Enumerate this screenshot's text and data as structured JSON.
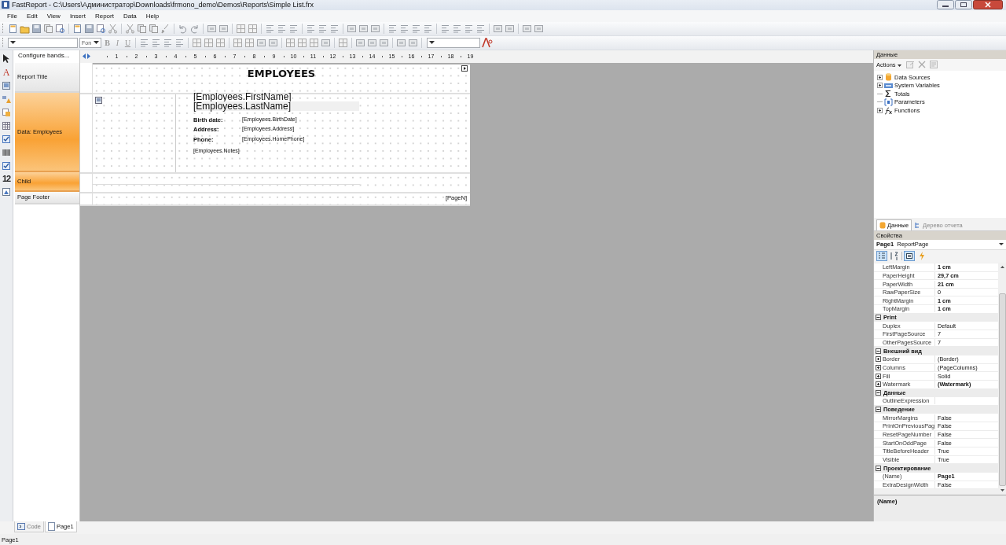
{
  "window": {
    "title": "FastReport - C:\\Users\\Администратор\\Downloads\\frmono_demo\\Demos\\Reports\\Simple List.frx"
  },
  "menu": [
    "File",
    "Edit",
    "View",
    "Insert",
    "Report",
    "Data",
    "Help"
  ],
  "format_toolbar": {
    "size_combo": "Fon",
    "bold": "B",
    "italic": "I",
    "underline": "U"
  },
  "tool_strip": {
    "text_tool": "A",
    "number_tool": "12"
  },
  "band_panel": {
    "configure": "Configure bands...",
    "bands": [
      {
        "label": "Report Title",
        "selected": false
      },
      {
        "label": "Data: Employees",
        "selected": true
      },
      {
        "label": "Child",
        "selected": true
      },
      {
        "label": "Page Footer",
        "selected": false
      }
    ]
  },
  "ruler": {
    "ticks": [
      "1",
      "2",
      "3",
      "4",
      "5",
      "6",
      "7",
      "8",
      "9",
      "10",
      "11",
      "12",
      "13",
      "14",
      "15",
      "16",
      "17",
      "18",
      "19"
    ]
  },
  "report": {
    "title": "EMPLOYEES",
    "first_name": "[Employees.FirstName]",
    "last_name": "[Employees.LastName]",
    "fields": [
      {
        "label": "Birth date:",
        "value": "[Employees.BirthDate]"
      },
      {
        "label": "Address:",
        "value": "[Employees.Address]"
      },
      {
        "label": "Phone:",
        "value": "[Employees.HomePhone]"
      }
    ],
    "notes": "[Employees.Notes]",
    "page_number": "[PageN]"
  },
  "data_panel": {
    "title": "Данные",
    "actions": "Actions",
    "tree": [
      {
        "label": "Data Sources",
        "kind": "datasource",
        "expandable": true
      },
      {
        "label": "System Variables",
        "kind": "variables",
        "expandable": true
      },
      {
        "label": "Totals",
        "kind": "totals",
        "expandable": false
      },
      {
        "label": "Parameters",
        "kind": "parameters",
        "expandable": false
      },
      {
        "label": "Functions",
        "kind": "functions",
        "expandable": true
      }
    ],
    "tabs": [
      {
        "label": "Данные",
        "selected": true
      },
      {
        "label": "Дерево отчета",
        "selected": false
      }
    ]
  },
  "properties": {
    "title": "Свойства",
    "object": {
      "name": "Page1",
      "type": "ReportPage"
    },
    "view_buttons": [
      {
        "kind": "categorized",
        "selected": true
      },
      {
        "kind": "alphabetical",
        "selected": false
      },
      {
        "kind": "properties",
        "selected": true
      },
      {
        "kind": "events",
        "selected": false
      }
    ],
    "rows": [
      {
        "kind": "prop",
        "name": "LeftMargin",
        "value": "1 cm",
        "modified": true,
        "expandable": false
      },
      {
        "kind": "prop",
        "name": "PaperHeight",
        "value": "29,7 cm",
        "modified": true,
        "expandable": false
      },
      {
        "kind": "prop",
        "name": "PaperWidth",
        "value": "21 cm",
        "modified": true,
        "expandable": false
      },
      {
        "kind": "prop",
        "name": "RawPaperSize",
        "value": "0",
        "modified": false,
        "expandable": false
      },
      {
        "kind": "prop",
        "name": "RightMargin",
        "value": "1 cm",
        "modified": true,
        "expandable": false
      },
      {
        "kind": "prop",
        "name": "TopMargin",
        "value": "1 cm",
        "modified": true,
        "expandable": false
      },
      {
        "kind": "category",
        "name": "Print",
        "expanded": true
      },
      {
        "kind": "prop",
        "name": "Duplex",
        "value": "Default",
        "modified": false,
        "expandable": false
      },
      {
        "kind": "prop",
        "name": "FirstPageSource",
        "value": "7",
        "modified": false,
        "expandable": false
      },
      {
        "kind": "prop",
        "name": "OtherPagesSource",
        "value": "7",
        "modified": false,
        "expandable": false
      },
      {
        "kind": "category",
        "name": "Внешний вид",
        "expanded": true
      },
      {
        "kind": "prop",
        "name": "Border",
        "value": "(Border)",
        "modified": false,
        "expandable": true
      },
      {
        "kind": "prop",
        "name": "Columns",
        "value": "(PageColumns)",
        "modified": false,
        "expandable": true
      },
      {
        "kind": "prop",
        "name": "Fill",
        "value": "Solid",
        "modified": false,
        "expandable": true
      },
      {
        "kind": "prop",
        "name": "Watermark",
        "value": "(Watermark)",
        "modified": true,
        "expandable": true
      },
      {
        "kind": "category",
        "name": "Данные",
        "expanded": true
      },
      {
        "kind": "prop",
        "name": "OutlineExpression",
        "expandable": false
      },
      {
        "kind": "category",
        "name": "Поведение",
        "expanded": true
      },
      {
        "kind": "prop",
        "name": "MirrorMargins",
        "value": "False",
        "modified": false,
        "expandable": false
      },
      {
        "kind": "prop",
        "name": "PrintOnPreviousPag",
        "value": "False",
        "modified": false,
        "expandable": false
      },
      {
        "kind": "prop",
        "name": "ResetPageNumber",
        "value": "False",
        "modified": false,
        "expandable": false
      },
      {
        "kind": "prop",
        "name": "StartOnOddPage",
        "value": "False",
        "modified": false,
        "expandable": false
      },
      {
        "kind": "prop",
        "name": "TitleBeforeHeader",
        "value": "True",
        "modified": false,
        "expandable": false
      },
      {
        "kind": "prop",
        "name": "Visible",
        "value": "True",
        "modified": false,
        "expandable": false
      },
      {
        "kind": "category",
        "name": "Проектирование",
        "expanded": true
      },
      {
        "kind": "prop",
        "name": "(Name)",
        "value": "Page1",
        "modified": true,
        "expandable": false
      },
      {
        "kind": "prop",
        "name": "ExtraDesignWidth",
        "value": "False",
        "modified": false,
        "expandable": false
      }
    ],
    "description": "(Name)"
  },
  "bottom_tabs": [
    {
      "label": "Code",
      "kind": "code",
      "selected": false
    },
    {
      "label": "Page1",
      "kind": "page",
      "selected": true
    }
  ],
  "status_bar": "Page1"
}
